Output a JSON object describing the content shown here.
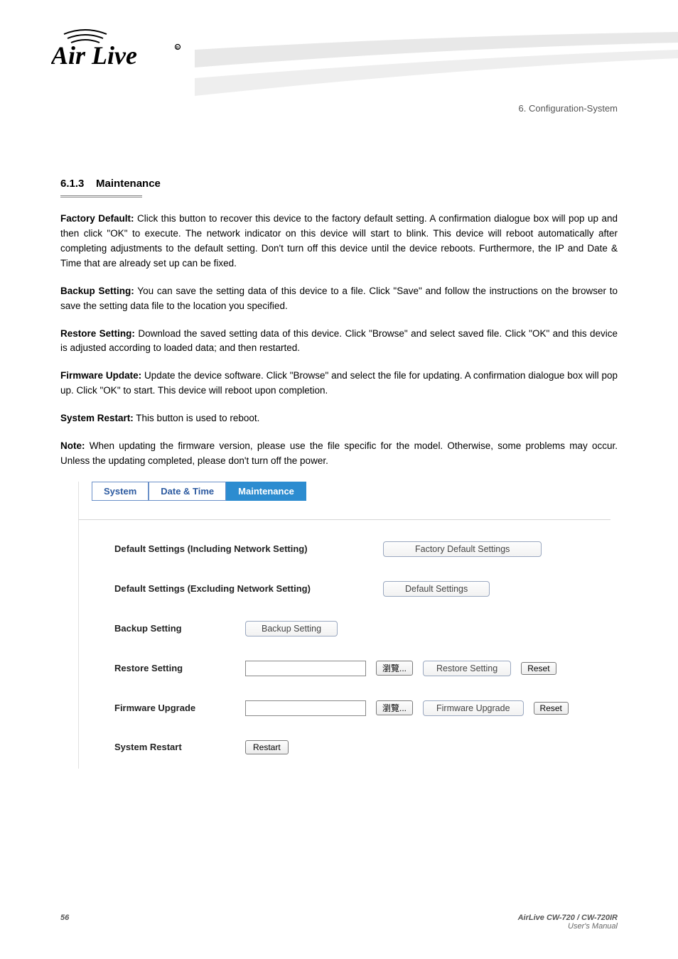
{
  "chapter_breadcrumb": "6. Configuration-System",
  "section_number": "6.1.3",
  "section_title": "Maintenance",
  "paragraphs": {
    "p1_label": "Factory Default:",
    "p1_text": " Click this button to recover this device to the factory default setting. A confirmation dialogue box will pop up and then click \"OK\" to execute. The network indicator on this device will start to blink. This device will reboot automatically after completing adjustments to the default setting. Don't turn off this device until the device reboots. Furthermore, the IP and Date & Time that are already set up can be fixed.",
    "p2_label": "Backup Setting:",
    "p2_text": " You can save the setting data of this device to a file. Click \"Save\" and follow the instructions on the browser to save the setting data file to the location you specified.",
    "p3_label": "Restore Setting:",
    "p3_text": " Download the saved setting data of this device. Click \"Browse\" and select saved file. Click \"OK\" and this device is adjusted according to loaded data; and then restarted.",
    "p4_label": "Firmware Update:",
    "p4_text": " Update the device software. Click \"Browse\" and select the file for updating. A confirmation dialogue box will pop up. Click \"OK\" to start. This device will reboot upon completion.",
    "p5_label": "System Restart:",
    "p5_text": " This button is used to reboot.",
    "note_label": "Note: ",
    "note_text": "When updating the firmware version, please use the file specific for the model. Otherwise, some problems may occur. Unless the updating completed, please don't turn off the power."
  },
  "tabs": {
    "system": "System",
    "datetime": "Date & Time",
    "maintenance": "Maintenance"
  },
  "panel": {
    "default_incl_label": "Default Settings (Including Network Setting)",
    "factory_default_btn": "Factory Default Settings",
    "default_excl_label": "Default Settings (Excluding Network Setting)",
    "default_settings_btn": "Default Settings",
    "backup_label": "Backup Setting",
    "backup_btn": "Backup Setting",
    "restore_label": "Restore Setting",
    "browse_btn": "瀏覽...",
    "restore_btn": "Restore Setting",
    "reset_btn": "Reset",
    "firmware_label": "Firmware Upgrade",
    "firmware_btn": "Firmware Upgrade",
    "sysrestart_label": "System Restart",
    "restart_btn": "Restart"
  },
  "footer": {
    "page": "56",
    "model": "AirLive CW-720 / CW-720IR",
    "sub": "User's Manual"
  }
}
